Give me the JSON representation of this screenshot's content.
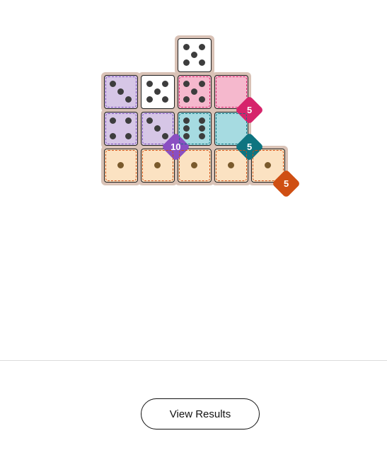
{
  "puzzle": {
    "grid_rows": 5,
    "grid_cols": 6,
    "cells": [
      {
        "row": 0,
        "col": 2,
        "value": 5,
        "region": null
      },
      {
        "row": 1,
        "col": 0,
        "value": 3,
        "region": "purple"
      },
      {
        "row": 1,
        "col": 1,
        "value": 5,
        "region": null
      },
      {
        "row": 1,
        "col": 2,
        "value": 5,
        "region": "pink"
      },
      {
        "row": 1,
        "col": 3,
        "value": 0,
        "region": "pink"
      },
      {
        "row": 2,
        "col": 0,
        "value": 4,
        "region": "purple"
      },
      {
        "row": 2,
        "col": 1,
        "value": 3,
        "region": "purple"
      },
      {
        "row": 2,
        "col": 2,
        "value": 6,
        "region": "teal"
      },
      {
        "row": 2,
        "col": 3,
        "value": 0,
        "region": "teal"
      },
      {
        "row": 3,
        "col": 0,
        "value": 1,
        "region": "orange"
      },
      {
        "row": 3,
        "col": 1,
        "value": 1,
        "region": "orange"
      },
      {
        "row": 3,
        "col": 2,
        "value": 1,
        "region": "orange"
      },
      {
        "row": 3,
        "col": 3,
        "value": 1,
        "region": "orange"
      },
      {
        "row": 3,
        "col": 4,
        "value": 1,
        "region": "orange"
      }
    ],
    "regions": [
      {
        "id": "pink",
        "target": "5",
        "fill": "#f5b8cd",
        "border": "#d6246b",
        "badge_color": "#d6246b",
        "cells": [
          [
            1,
            2
          ],
          [
            1,
            3
          ]
        ]
      },
      {
        "id": "purple",
        "target": "10",
        "fill": "#d6c6e6",
        "border": "#7b4fbd",
        "badge_color": "#8a4fc2",
        "cells": [
          [
            1,
            0
          ],
          [
            2,
            0
          ],
          [
            2,
            1
          ]
        ]
      },
      {
        "id": "teal",
        "target": "5",
        "fill": "#a6dbe1",
        "border": "#0e7480",
        "badge_color": "#0e7480",
        "cells": [
          [
            2,
            2
          ],
          [
            2,
            3
          ]
        ]
      },
      {
        "id": "orange",
        "target": "5",
        "fill": "#fbe2c2",
        "border": "#cf4f13",
        "badge_color": "#cf4f13",
        "cells": [
          [
            3,
            0
          ],
          [
            3,
            1
          ],
          [
            3,
            2
          ],
          [
            3,
            3
          ],
          [
            3,
            4
          ]
        ]
      }
    ]
  },
  "footer": {
    "view_results_label": "View Results"
  }
}
